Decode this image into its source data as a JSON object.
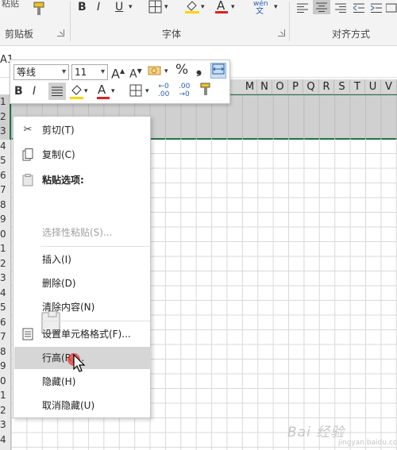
{
  "ribbon": {
    "top_label_clipped": "粘贴",
    "bold": "B",
    "italic": "I",
    "underline": "U",
    "font_color_letter": "A",
    "phonetic_top": "wén",
    "phonetic_bottom": "文",
    "groups": {
      "clipboard": "剪贴板",
      "font": "字体",
      "alignment": "对齐方式"
    }
  },
  "namebox": "A1",
  "columns": [
    "M",
    "N",
    "O",
    "P",
    "Q",
    "R",
    "S",
    "T",
    "U",
    "V"
  ],
  "rows": [
    "1",
    "2",
    "3",
    "4",
    "5",
    "6",
    "7",
    "8",
    "9",
    "0",
    "1",
    "2",
    "3",
    "4",
    "5",
    "6",
    "7",
    "8",
    "9",
    "0",
    "1",
    "2",
    "3",
    "4"
  ],
  "mini_toolbar": {
    "font_name": "等线",
    "font_size": "11",
    "grow_font": "A",
    "shrink_font": "A",
    "percent": "%",
    "comma": "❟",
    "bold": "B",
    "italic": "I",
    "font_color_letter": "A",
    "increase_decimal": "←0\n.00",
    "decrease_decimal": ".00\n→0"
  },
  "context_menu": {
    "items": [
      {
        "label": "剪切(T)",
        "icon": "scissors-icon",
        "enabled": true
      },
      {
        "label": "复制(C)",
        "icon": "copy-icon",
        "enabled": true
      },
      {
        "label": "粘贴选项:",
        "icon": "paste-options-icon",
        "enabled": true,
        "bold": true
      },
      {
        "label": "选择性粘贴(S)...",
        "icon": "",
        "enabled": false
      },
      {
        "label": "插入(I)",
        "icon": "",
        "enabled": true
      },
      {
        "label": "删除(D)",
        "icon": "",
        "enabled": true
      },
      {
        "label": "清除内容(N)",
        "icon": "",
        "enabled": true
      },
      {
        "label": "设置单元格格式(F)...",
        "icon": "format-cells-icon",
        "enabled": true
      },
      {
        "label": "行高(R)...",
        "icon": "",
        "enabled": true,
        "hovered": true
      },
      {
        "label": "隐藏(H)",
        "icon": "",
        "enabled": true
      },
      {
        "label": "取消隐藏(U)",
        "icon": "",
        "enabled": true
      }
    ]
  },
  "watermark": {
    "text": "Bai  经验",
    "sub": "jingyan.baidu.com"
  },
  "colors": {
    "selection_green": "#217346",
    "font_color_red": "#e02020",
    "fill_yellow": "#ffd400",
    "hover_gray": "#d6d6d6"
  }
}
